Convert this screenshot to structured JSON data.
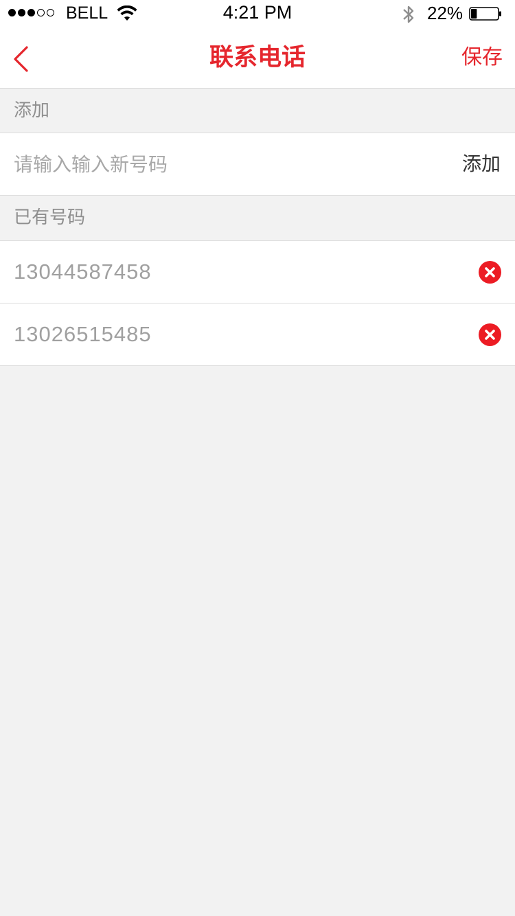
{
  "status_bar": {
    "carrier": "BELL",
    "time": "4:21 PM",
    "battery_percent": "22%",
    "battery_level": 0.22,
    "signal_bars": 3,
    "signal_total": 5
  },
  "nav": {
    "title": "联系电话",
    "save_label": "保存",
    "back_icon": "chevron-left-icon"
  },
  "add_section": {
    "header": "添加",
    "input_placeholder": "请输入输入新号码",
    "input_value": "",
    "add_label": "添加"
  },
  "existing_section": {
    "header": "已有号码",
    "numbers": [
      {
        "number": "13044587458"
      },
      {
        "number": "13026515485"
      }
    ]
  },
  "colors": {
    "accent": "#e5262d",
    "delete": "#ec1c24",
    "background": "#f2f2f2"
  }
}
